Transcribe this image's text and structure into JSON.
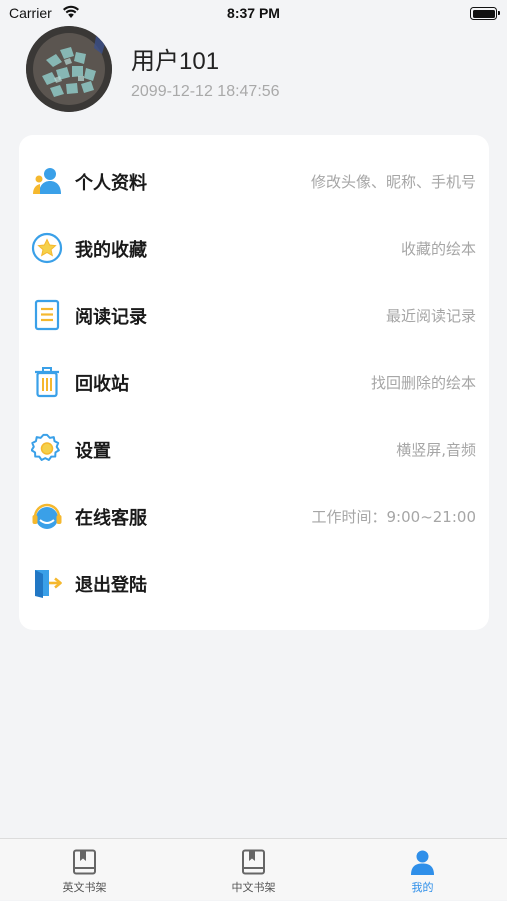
{
  "status_bar": {
    "carrier": "Carrier",
    "time": "8:37 PM"
  },
  "profile": {
    "name": "用户101",
    "timestamp": "2099-12-12 18:47:56"
  },
  "menu": {
    "items": [
      {
        "label": "个人资料",
        "hint": "修改头像、昵称、手机号",
        "icon": "person-icon"
      },
      {
        "label": "我的收藏",
        "hint": "收藏的绘本",
        "icon": "star-icon"
      },
      {
        "label": "阅读记录",
        "hint": "最近阅读记录",
        "icon": "document-icon"
      },
      {
        "label": "回收站",
        "hint": "找回删除的绘本",
        "icon": "trash-icon"
      },
      {
        "label": "设置",
        "hint": "横竖屏,音频",
        "icon": "gear-icon"
      },
      {
        "label": "在线客服",
        "hint": "工作时间：9:00~21:00",
        "icon": "headset-icon"
      },
      {
        "label": "退出登陆",
        "hint": "",
        "icon": "logout-icon"
      }
    ]
  },
  "tab_bar": {
    "tabs": [
      {
        "label": "英文书架",
        "icon": "book-icon",
        "active": false
      },
      {
        "label": "中文书架",
        "icon": "book-icon",
        "active": false
      },
      {
        "label": "我的",
        "icon": "person-icon",
        "active": true
      }
    ]
  },
  "colors": {
    "accent": "#2f8fe9",
    "icon_blue": "#3aa0e8",
    "icon_yellow": "#f5b82e",
    "background": "#f3f4f6"
  }
}
